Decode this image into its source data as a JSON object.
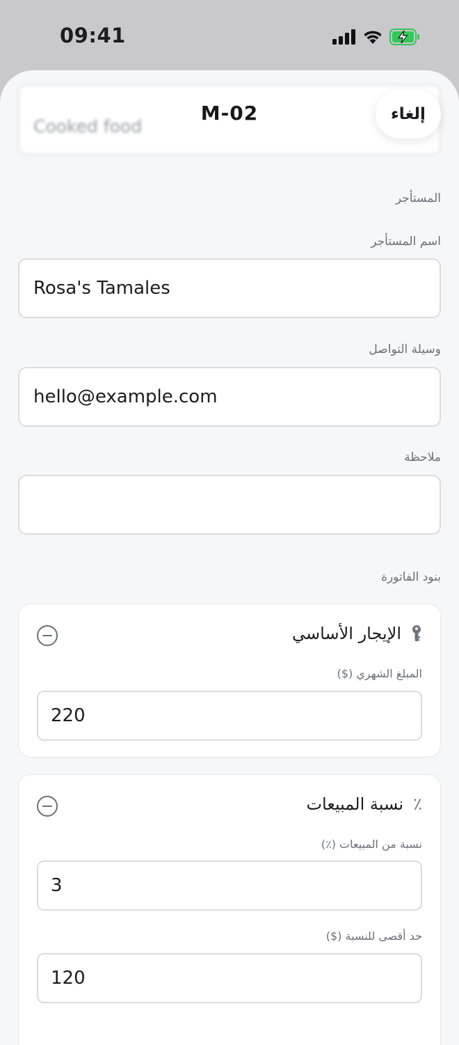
{
  "status_bar": {
    "time": "09:41",
    "icons": [
      "cellular-signal-icon",
      "wifi-icon",
      "battery-charging-icon"
    ],
    "battery_color": "#34c759"
  },
  "sheet": {
    "title": "M-02",
    "cancel_label": "إلغاء",
    "blurred_value": "Cooked food"
  },
  "tenant": {
    "section_label": "المستأجر",
    "name_label": "اسم المستأجر",
    "name_value": "Rosa's Tamales",
    "contact_label": "وسيلة التواصل",
    "contact_value": "hello@example.com",
    "note_label": "ملاحظة",
    "note_value": ""
  },
  "invoice": {
    "section_label": "بنود الفاتورة",
    "items": [
      {
        "title": "الإيجار الأساسي",
        "icon": "key-icon",
        "fields": [
          {
            "label": "المبلغ الشهري ($)",
            "value": "220"
          }
        ]
      },
      {
        "title": "نسبة المبيعات",
        "icon": "percent-icon",
        "icon_glyph": "٪",
        "fields": [
          {
            "label": "نسبة من المبيعات (٪)",
            "value": "3"
          },
          {
            "label": "حد أقصى للنسبة ($)",
            "value": "120"
          }
        ]
      }
    ]
  }
}
